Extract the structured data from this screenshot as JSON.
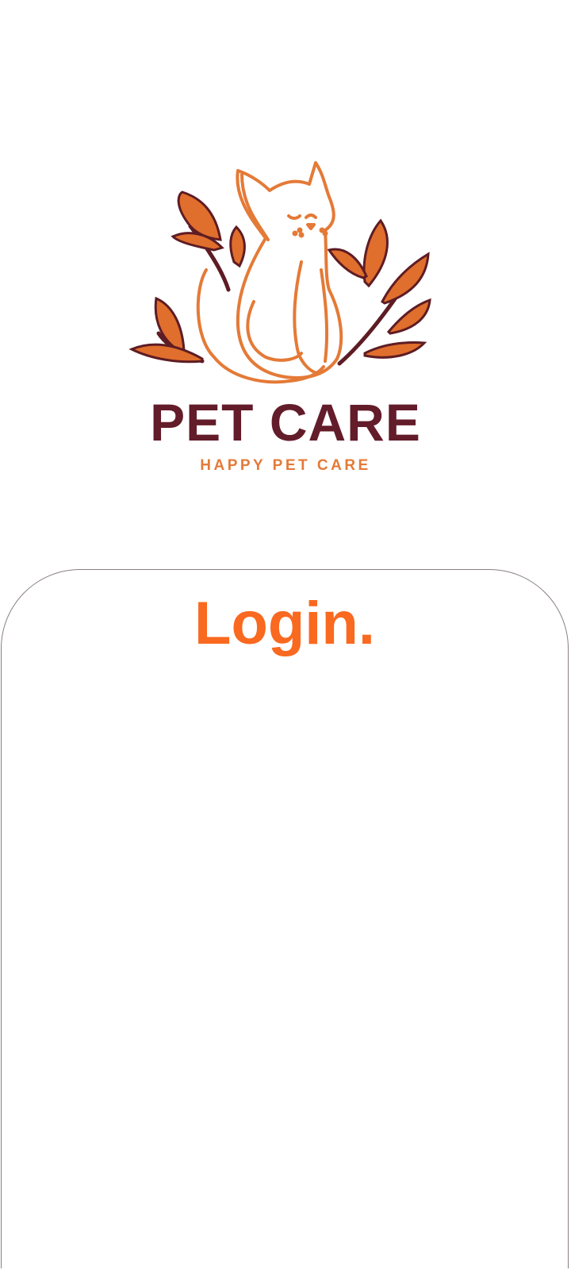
{
  "logo": {
    "icon": "cat-with-leaves-icon",
    "brand_name": "PET CARE",
    "tagline": "HAPPY PET CARE",
    "colors": {
      "outline": "#E47A37",
      "leaf_fill": "#E06E2C",
      "leaf_stroke": "#5E1C24",
      "brand_text": "#631C2A",
      "tagline_text": "#E47A37"
    }
  },
  "login": {
    "title": "Login.",
    "title_color": "#F9691F"
  }
}
